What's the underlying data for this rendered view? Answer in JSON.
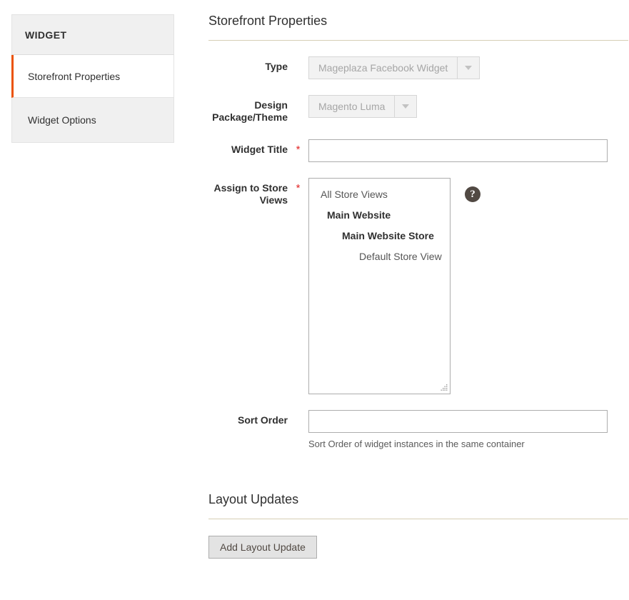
{
  "sidebar": {
    "header": "WIDGET",
    "items": [
      {
        "label": "Storefront Properties",
        "active": true
      },
      {
        "label": "Widget Options",
        "active": false
      }
    ],
    "accent_color": "#eb5202"
  },
  "main": {
    "storefront_properties": {
      "title": "Storefront Properties",
      "fields": {
        "type": {
          "label": "Type",
          "value": "Mageplaza Facebook Widget",
          "disabled": true,
          "arrow_icon": "chevron-down-icon"
        },
        "design_theme": {
          "label": "Design Package/Theme",
          "value": "Magento Luma",
          "disabled": true,
          "arrow_icon": "chevron-down-icon"
        },
        "widget_title": {
          "label": "Widget Title",
          "value": "",
          "required_marker": "*"
        },
        "assign_store_views": {
          "label": "Assign to Store Views",
          "required_marker": "*",
          "help_icon": "question-mark-icon",
          "options": [
            {
              "label": "All Store Views",
              "level": 1
            },
            {
              "label": "Main Website",
              "level": 2
            },
            {
              "label": "Main Website Store",
              "level": 3
            },
            {
              "label": "Default Store View",
              "level": 4
            }
          ]
        },
        "sort_order": {
          "label": "Sort Order",
          "value": "",
          "note": "Sort Order of widget instances in the same container"
        }
      }
    },
    "layout_updates": {
      "title": "Layout Updates",
      "add_button": "Add Layout Update"
    }
  }
}
